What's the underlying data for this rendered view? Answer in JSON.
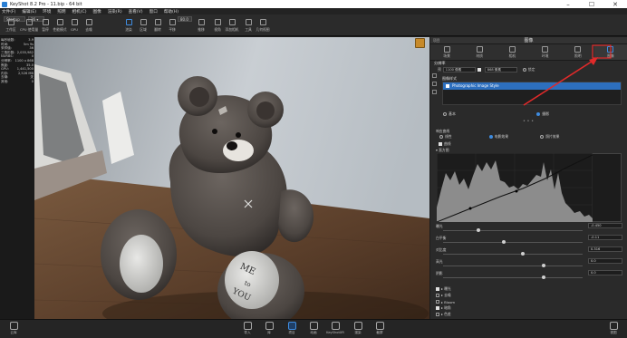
{
  "window": {
    "title": "KeyShot 8.2 Pro - 11.bip - 64 bit",
    "controls": [
      "–",
      "☐",
      "✕"
    ]
  },
  "menu": [
    "文件(F)",
    "编辑(E)",
    "环境",
    "照明",
    "相机(C)",
    "图像",
    "渲染(R)",
    "查看(V)",
    "窗口",
    "帮助(H)"
  ],
  "toolbar": {
    "workspace_select": "Startup",
    "cores_select": "36 ▾",
    "pause_label": "暂停",
    "zoom_value": "80.0",
    "buttons": [
      {
        "label": "工作区",
        "icon": "workspace-icon"
      },
      {
        "label": "CPU 使用量",
        "icon": "cpu-icon"
      },
      {
        "label": "暂停",
        "icon": "pause-icon"
      },
      {
        "label": "性能模式",
        "icon": "performance-icon"
      },
      {
        "label": "GPU",
        "icon": "gpu-icon"
      },
      {
        "label": "去噪",
        "icon": "denoise-icon"
      },
      {
        "label": "渲染",
        "icon": "render-icon"
      },
      {
        "label": "区域",
        "icon": "region-icon"
      },
      {
        "label": "翻转",
        "icon": "tumble-icon"
      },
      {
        "label": "平移",
        "icon": "pan-icon"
      },
      {
        "label": "推移",
        "icon": "dolly-icon"
      },
      {
        "label": "视角",
        "icon": "perspective-icon"
      },
      {
        "label": "添加相机",
        "icon": "add-camera-icon"
      },
      {
        "label": "工具",
        "icon": "tools-icon"
      },
      {
        "label": "几何视图",
        "icon": "geometry-view-icon"
      }
    ]
  },
  "left_info": [
    {
      "k": "每秒帧数:",
      "v": "3.9"
    },
    {
      "k": "时间:",
      "v": "5m 9s"
    },
    {
      "k": "采样值:",
      "v": "36"
    },
    {
      "k": "三角形数:",
      "v": "2,035,982"
    },
    {
      "k": "NURBS:",
      "v": "0"
    },
    {
      "k": "分辨率:",
      "v": "1100 x 868"
    },
    {
      "k": "焦距:",
      "v": "35.0"
    },
    {
      "k": "GPU:",
      "v": "1,441,500"
    },
    {
      "k": "内存:",
      "v": "2,526 MB"
    },
    {
      "k": "去噪:",
      "v": "关"
    },
    {
      "k": "其他:",
      "v": "0"
    }
  ],
  "right_panel": {
    "header_left": "项目",
    "title": "图像",
    "tabs": [
      {
        "label": "场景",
        "icon": "scene-icon",
        "active": false
      },
      {
        "label": "材质",
        "icon": "material-icon",
        "active": false
      },
      {
        "label": "相机",
        "icon": "camera-icon",
        "active": false
      },
      {
        "label": "环境",
        "icon": "environment-icon",
        "active": false
      },
      {
        "label": "照明",
        "icon": "lighting-icon",
        "active": false
      },
      {
        "label": "图像",
        "icon": "image-icon",
        "active": true
      }
    ],
    "resolution_title": "分辨率",
    "resolution": {
      "preset_label": "预",
      "width": "1100 像素",
      "height": "868 像素",
      "lock_label": "锁定"
    },
    "image_style_title": "图像样式",
    "style_item": "Photographic Image Style",
    "mode": {
      "basic": "基本",
      "photographic": "摄影"
    },
    "response": {
      "title": "响应曲线",
      "linear": "线性",
      "filmic": "电影效果",
      "photographic": "照片效果"
    },
    "curve_label": "曲线",
    "histogram_label": "直方图",
    "props": [
      {
        "label": "曝光",
        "value": "-0.450",
        "knob": 0.24
      },
      {
        "label": "白平衡",
        "value": "-0.11",
        "knob": 0.42
      },
      {
        "label": "对比度",
        "value": "0.316",
        "knob": 0.56
      },
      {
        "label": "高光",
        "value": "0.0",
        "knob": 0.71
      },
      {
        "label": "阴影",
        "value": "0.0",
        "knob": 0.71
      }
    ],
    "layers": [
      {
        "label": "▸ 曝光",
        "checked": true
      },
      {
        "label": "▸ 去噪",
        "checked": false
      },
      {
        "label": "▸ Bloom",
        "checked": false
      },
      {
        "label": "▸ 暗角",
        "checked": true
      },
      {
        "label": "▸ 色差",
        "checked": false
      }
    ]
  },
  "bottom": {
    "cloud_label": "云库",
    "buttons": [
      {
        "label": "导入",
        "icon": "import-icon",
        "active": false
      },
      {
        "label": "库",
        "icon": "library-icon",
        "active": false
      },
      {
        "label": "项目",
        "icon": "project-icon",
        "active": true
      },
      {
        "label": "动画",
        "icon": "animation-icon",
        "active": false
      },
      {
        "label": "KeyShotXR",
        "icon": "keyshotxr-icon",
        "active": false
      },
      {
        "label": "渲染",
        "icon": "render-output-icon",
        "active": false
      },
      {
        "label": "截屏",
        "icon": "screenshot-icon",
        "active": false
      }
    ],
    "expert_label": "视图"
  },
  "colors": {
    "accent": "#3f8ce0",
    "annotation_arrow": "#e02a2a",
    "selected_row": "#2d6fbe"
  }
}
